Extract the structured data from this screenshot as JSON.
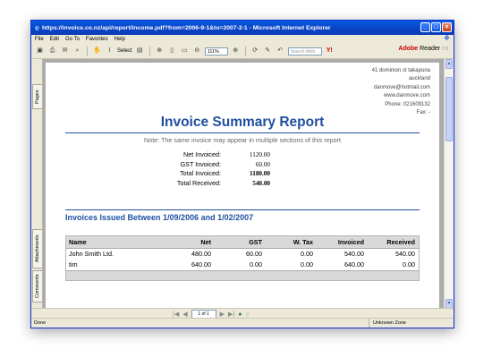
{
  "window": {
    "title": "https://invoice.co.nz/api/report/income.pdf?from=2006-9-1&to=2007-2-1 - Microsoft Internet Explorer"
  },
  "menu": [
    "File",
    "Edit",
    "Go To",
    "Favorites",
    "Help"
  ],
  "toolbar": {
    "select_label": "Select",
    "zoom": "111%",
    "search_placeholder": "Search Web",
    "adobe_brand": "Adobe",
    "adobe_reader": "Reader",
    "adobe_version": "7.0"
  },
  "nav_tabs": {
    "pages": "Pages",
    "attachments": "Attachments",
    "comments": "Comments"
  },
  "company": {
    "address1": "41 dominion st takapuna",
    "address2": "auckland",
    "email": "danmove@hotmail.com",
    "website": "www.danmove.com",
    "phone": "Phone: 021609132",
    "fax": "Fax: -"
  },
  "report": {
    "title": "Invoice Summary Report",
    "note": "Note: The same invoice may appear in multiple sections of this report",
    "totals": [
      {
        "label": "Net Invoiced:",
        "value": "1120.00"
      },
      {
        "label": "GST Invoiced:",
        "value": "60.00"
      },
      {
        "label": "Total Invoiced:",
        "value": "1180.00"
      },
      {
        "label": "Total Received:",
        "value": "540.00"
      }
    ],
    "section_title": "Invoices Issued Between 1/09/2006 and 1/02/2007",
    "table": {
      "headers": [
        "Name",
        "Net",
        "GST",
        "W. Tax",
        "Invoiced",
        "Received"
      ],
      "rows": [
        [
          "John Smith Ltd.",
          "480.00",
          "60.00",
          "0.00",
          "540.00",
          "540.00"
        ],
        [
          "tim",
          "640.00",
          "0.00",
          "0.00",
          "640.00",
          "0.00"
        ]
      ]
    }
  },
  "pager": {
    "page_text": "1 of 1"
  },
  "status": {
    "left": "Done",
    "zone": "Unknown Zone"
  },
  "colors": {
    "title_blue": "#1f4fa0",
    "xp_titlebar": "#0a5be0"
  }
}
